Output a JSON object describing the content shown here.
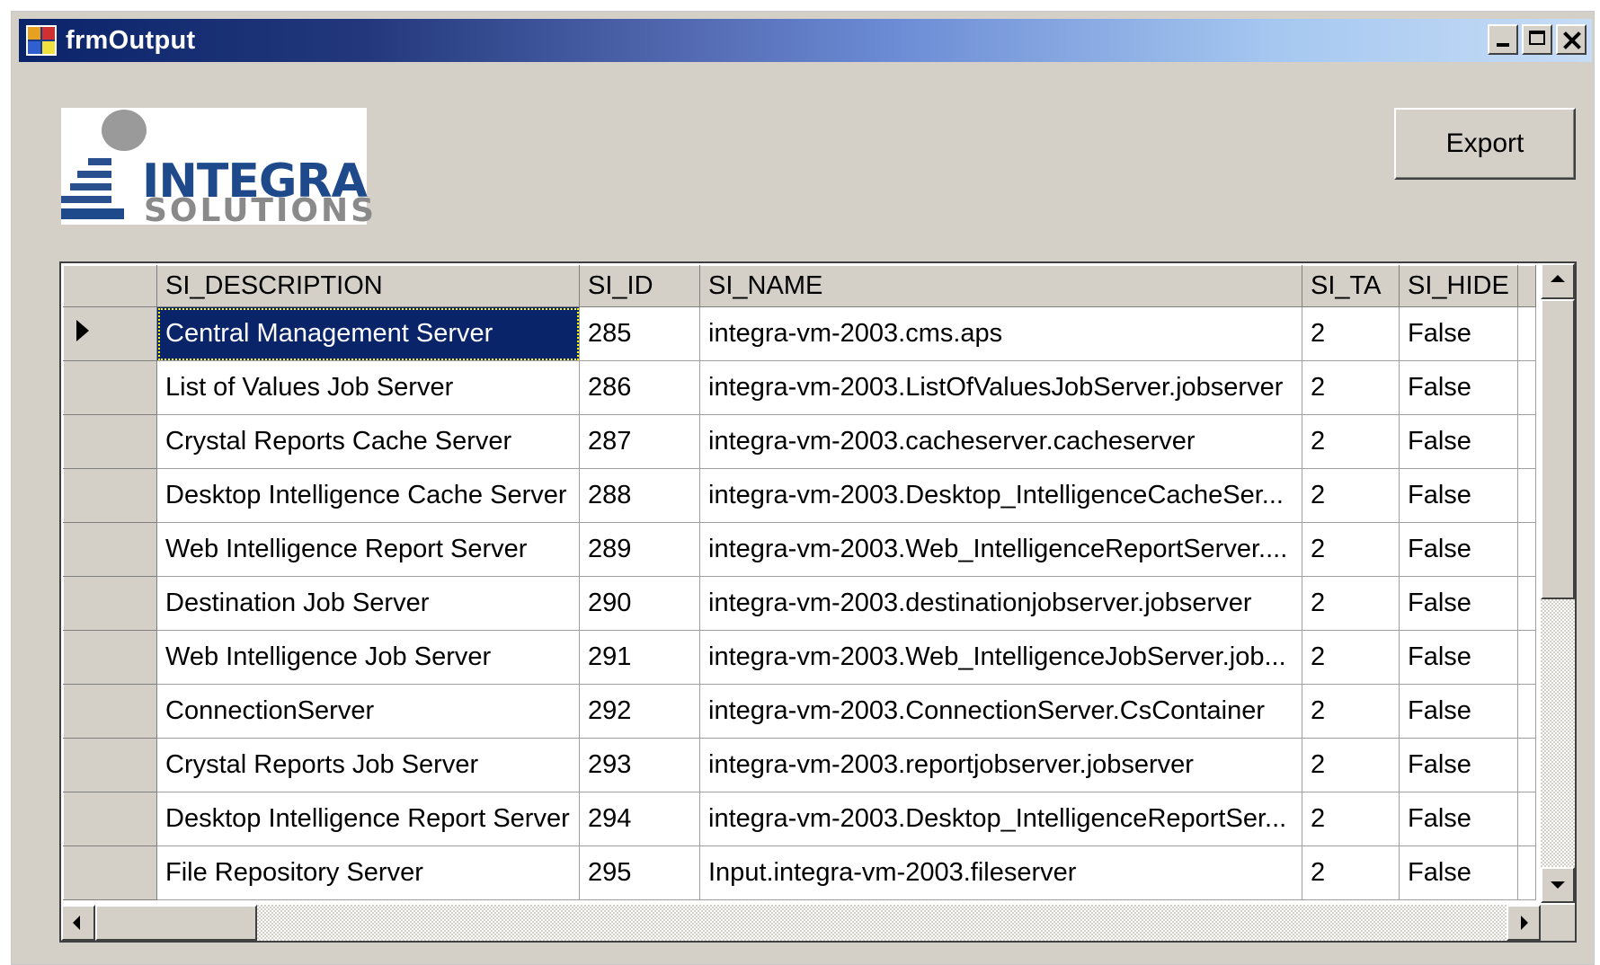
{
  "window": {
    "title": "frmOutput",
    "app_icon": "form-app-icon",
    "controls": [
      "minimize-icon",
      "maximize-icon",
      "close-icon"
    ]
  },
  "logo": {
    "line1": "INTEGRA",
    "line2": "SOLUTIONS"
  },
  "export_label": "Export",
  "grid": {
    "columns": [
      "SI_DESCRIPTION",
      "SI_ID",
      "SI_NAME",
      "SI_TA",
      "SI_HIDE"
    ],
    "selected_row": 0,
    "rows": [
      [
        "Central Management Server",
        "285",
        "integra-vm-2003.cms.aps",
        "2",
        "False"
      ],
      [
        "List of Values Job Server",
        "286",
        "integra-vm-2003.ListOfValuesJobServer.jobserver",
        "2",
        "False"
      ],
      [
        "Crystal Reports Cache Server",
        "287",
        "integra-vm-2003.cacheserver.cacheserver",
        "2",
        "False"
      ],
      [
        "Desktop Intelligence Cache Server",
        "288",
        "integra-vm-2003.Desktop_IntelligenceCacheSer...",
        "2",
        "False"
      ],
      [
        "Web Intelligence Report Server",
        "289",
        "integra-vm-2003.Web_IntelligenceReportServer....",
        "2",
        "False"
      ],
      [
        "Destination Job Server",
        "290",
        "integra-vm-2003.destinationjobserver.jobserver",
        "2",
        "False"
      ],
      [
        "Web Intelligence Job Server",
        "291",
        "integra-vm-2003.Web_IntelligenceJobServer.job...",
        "2",
        "False"
      ],
      [
        "ConnectionServer",
        "292",
        "integra-vm-2003.ConnectionServer.CsContainer",
        "2",
        "False"
      ],
      [
        "Crystal Reports Job Server",
        "293",
        "integra-vm-2003.reportjobserver.jobserver",
        "2",
        "False"
      ],
      [
        "Desktop Intelligence Report Server",
        "294",
        "integra-vm-2003.Desktop_IntelligenceReportSer...",
        "2",
        "False"
      ],
      [
        "File Repository Server",
        "295",
        "Input.integra-vm-2003.fileserver",
        "2",
        "False"
      ]
    ]
  },
  "scrollbars": {
    "vertical": [
      "scroll-up-icon",
      "scroll-down-icon"
    ],
    "horizontal": [
      "scroll-left-icon",
      "scroll-right-icon"
    ]
  }
}
